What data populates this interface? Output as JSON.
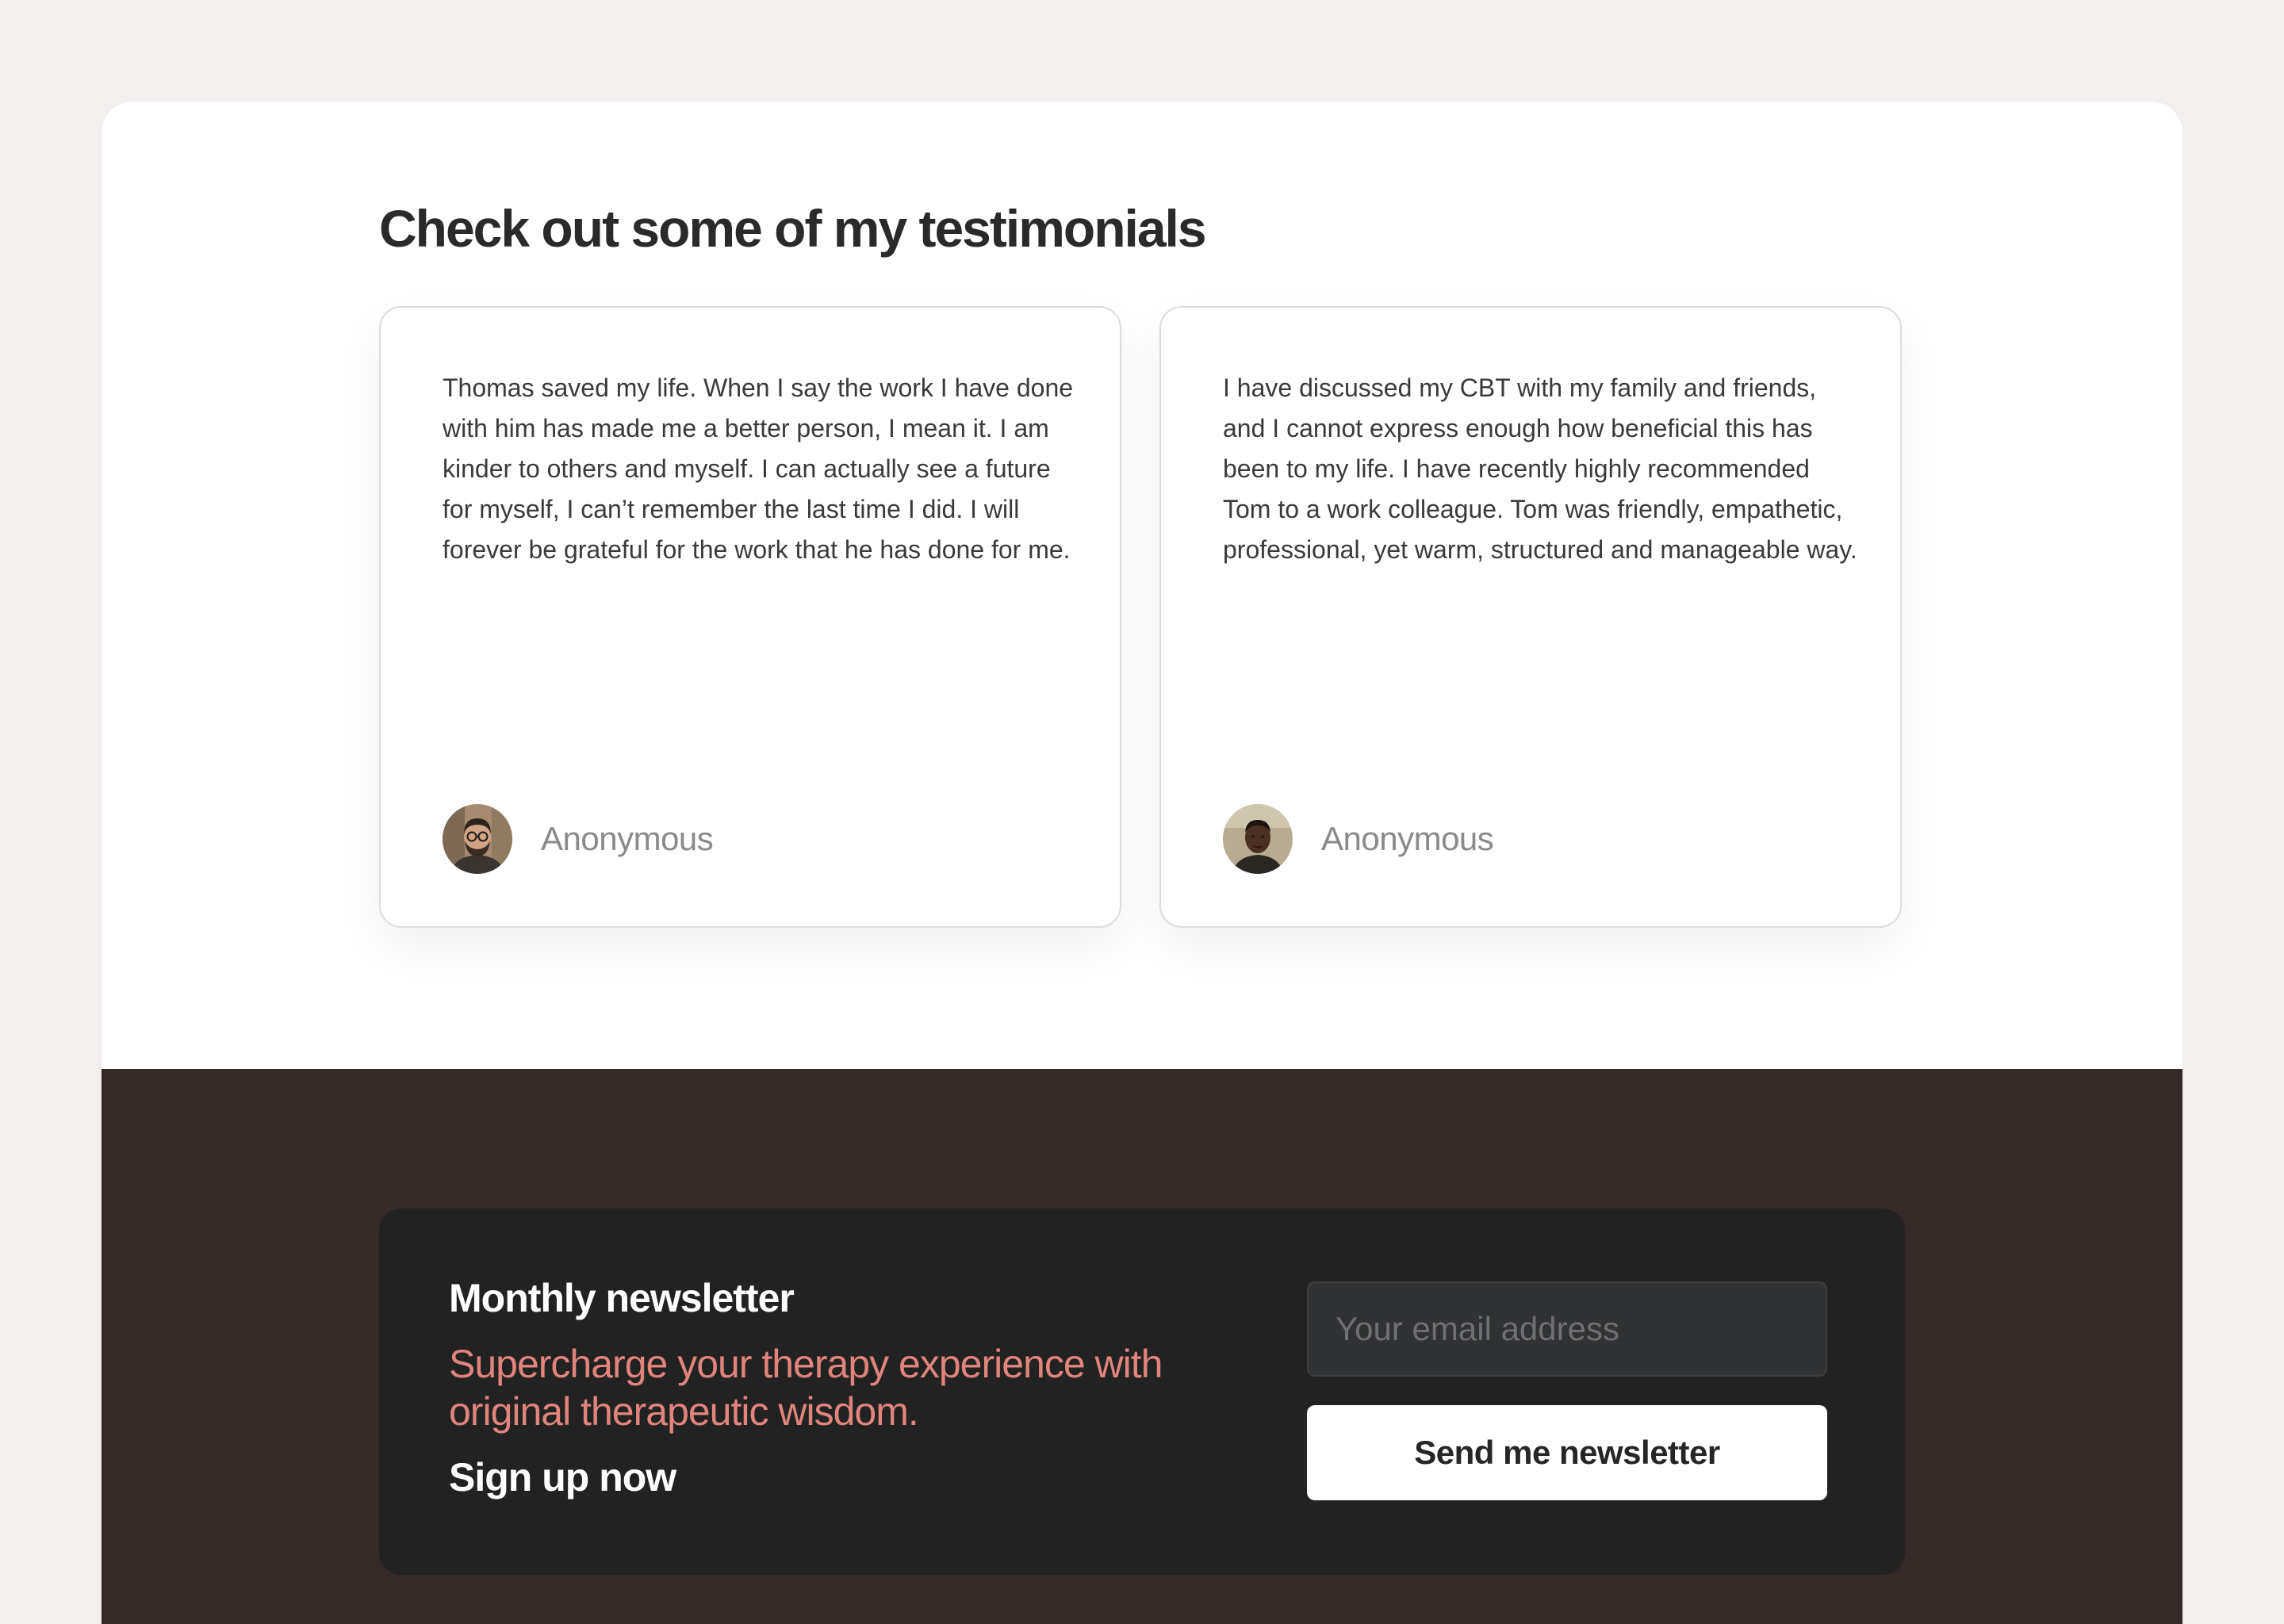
{
  "testimonials": {
    "title": "Check out some of my testimonials",
    "cards": [
      {
        "quote": "Thomas saved my life. When I say the work I have done with him has made me a better person, I mean it. I am kinder to others and myself. I can actually see a future for myself, I can’t remember the last time I did. I will forever be grateful for the work that he has done for me.",
        "author": "Anonymous",
        "avatar_icon": "person-avatar-glasses-beard"
      },
      {
        "quote": "I have discussed my CBT with my family and friends, and I cannot express enough how beneficial this has been to my life. I have recently highly recommended Tom to a work colleague. Tom was friendly, empathetic, professional, yet warm, structured and manageable way.",
        "author": "Anonymous",
        "avatar_icon": "person-avatar"
      }
    ]
  },
  "newsletter": {
    "title": "Monthly newsletter",
    "subtitle": "Supercharge your therapy experience with original therapeutic wisdom.",
    "cta": "Sign up now",
    "email_placeholder": "Your email address",
    "email_value": "",
    "button_label": "Send me newsletter"
  },
  "colors": {
    "page_background": "#f3efef",
    "footer_background": "#352a27",
    "newsletter_background": "#222222",
    "accent": "#e0847d",
    "title_text": "#2a2a2a"
  }
}
